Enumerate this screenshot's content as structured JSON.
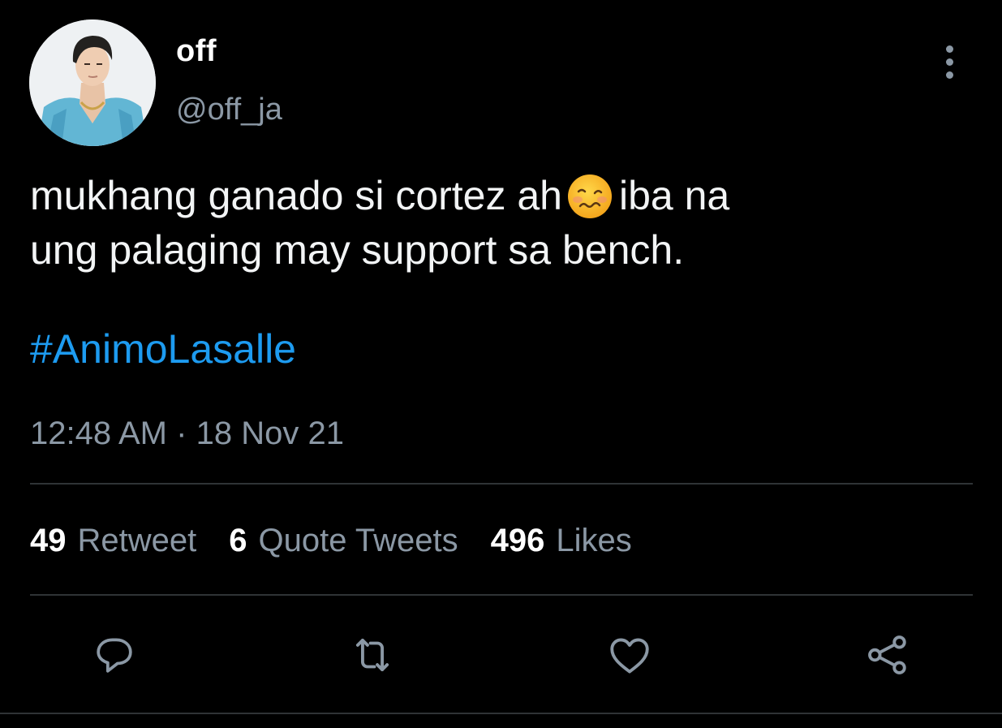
{
  "tweet": {
    "author": {
      "display_name": "off",
      "handle": "@off_ja"
    },
    "text_line1_before_emoji": "mukhang ganado si cortez ah",
    "emoji_icon": "woozy-face-emoji",
    "text_line1_after_emoji": "iba na",
    "text_line2": "ung palaging may support sa bench.",
    "hashtag": "#AnimoLasalle",
    "time": "12:48 AM",
    "separator": "·",
    "date": "18 Nov 21"
  },
  "stats": {
    "retweets": {
      "count": "49",
      "label": "Retweet"
    },
    "quotes": {
      "count": "6",
      "label": "Quote Tweets"
    },
    "likes": {
      "count": "496",
      "label": "Likes"
    }
  },
  "actions": {
    "reply_icon": "reply-icon",
    "retweet_icon": "retweet-icon",
    "like_icon": "heart-icon",
    "share_icon": "share-icon",
    "more_icon": "more-vertical-icon"
  },
  "colors": {
    "background": "#000000",
    "text": "#ffffff",
    "secondary_text": "#8b98a5",
    "link": "#1d9bf0",
    "divider": "#2f3336"
  }
}
